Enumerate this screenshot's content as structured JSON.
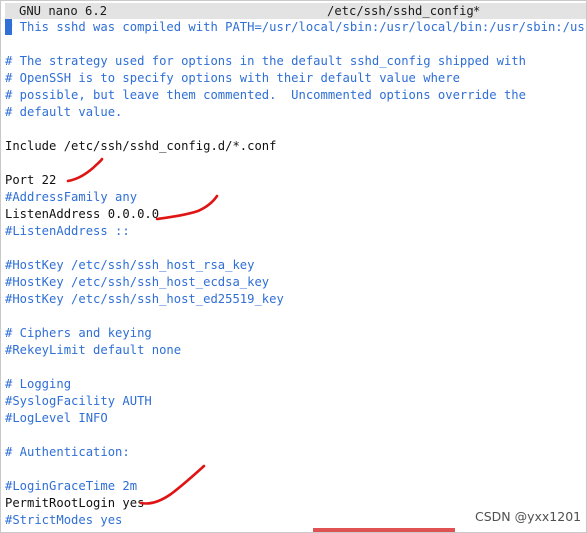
{
  "window": {
    "app_label": "GNU nano 6.2",
    "file_label": "/etc/ssh/sshd_config",
    "modified_marker": "*"
  },
  "colors": {
    "comment": "#2f6fd6",
    "text": "#111111",
    "titlebar_bg": "#e3e3e3",
    "annotation": "#e01414"
  },
  "editor": {
    "lines": [
      {
        "text": "# This sshd was compiled with PATH=/usr/local/sbin:/usr/local/bin:/usr/sbin:/usr/bin",
        "kind": "comment"
      },
      {
        "text": "",
        "kind": "blank"
      },
      {
        "text": "# The strategy used for options in the default sshd_config shipped with",
        "kind": "comment"
      },
      {
        "text": "# OpenSSH is to specify options with their default value where",
        "kind": "comment"
      },
      {
        "text": "# possible, but leave them commented.  Uncommented options override the",
        "kind": "comment"
      },
      {
        "text": "# default value.",
        "kind": "comment"
      },
      {
        "text": "",
        "kind": "blank"
      },
      {
        "text": "Include /etc/ssh/sshd_config.d/*.conf",
        "kind": "directive"
      },
      {
        "text": "",
        "kind": "blank"
      },
      {
        "text": "Port 22",
        "kind": "directive"
      },
      {
        "text": "#AddressFamily any",
        "kind": "comment"
      },
      {
        "text": "ListenAddress 0.0.0.0",
        "kind": "directive"
      },
      {
        "text": "#ListenAddress ::",
        "kind": "comment"
      },
      {
        "text": "",
        "kind": "blank"
      },
      {
        "text": "#HostKey /etc/ssh/ssh_host_rsa_key",
        "kind": "comment"
      },
      {
        "text": "#HostKey /etc/ssh/ssh_host_ecdsa_key",
        "kind": "comment"
      },
      {
        "text": "#HostKey /etc/ssh/ssh_host_ed25519_key",
        "kind": "comment"
      },
      {
        "text": "",
        "kind": "blank"
      },
      {
        "text": "# Ciphers and keying",
        "kind": "comment"
      },
      {
        "text": "#RekeyLimit default none",
        "kind": "comment"
      },
      {
        "text": "",
        "kind": "blank"
      },
      {
        "text": "# Logging",
        "kind": "comment"
      },
      {
        "text": "#SyslogFacility AUTH",
        "kind": "comment"
      },
      {
        "text": "#LogLevel INFO",
        "kind": "comment"
      },
      {
        "text": "",
        "kind": "blank"
      },
      {
        "text": "# Authentication:",
        "kind": "comment"
      },
      {
        "text": "",
        "kind": "blank"
      },
      {
        "text": "#LoginGraceTime 2m",
        "kind": "comment"
      },
      {
        "text": "PermitRootLogin yes",
        "kind": "directive"
      },
      {
        "text": "#StrictModes yes",
        "kind": "comment"
      }
    ]
  },
  "watermark": {
    "text": "CSDN @yxx1201"
  }
}
